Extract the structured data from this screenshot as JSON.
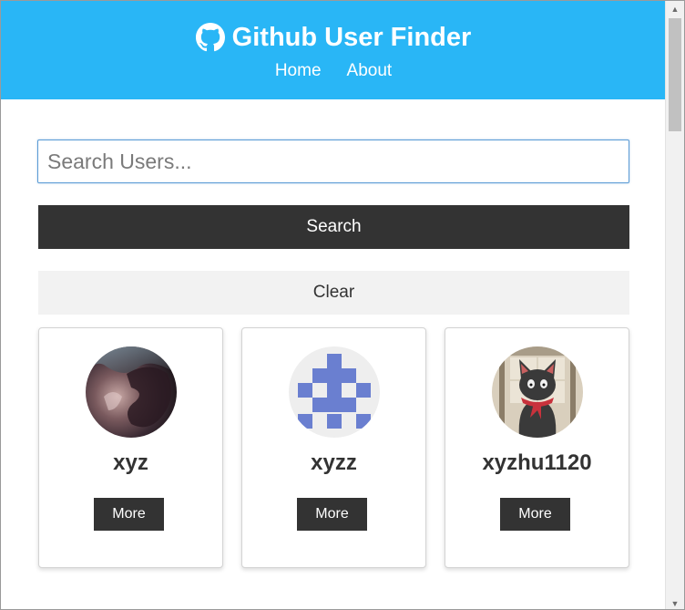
{
  "navbar": {
    "title": "Github User Finder",
    "icon": "github-icon",
    "links": [
      {
        "label": "Home"
      },
      {
        "label": "About"
      }
    ]
  },
  "search": {
    "placeholder": "Search Users...",
    "value": "",
    "search_label": "Search",
    "clear_label": "Clear"
  },
  "users": [
    {
      "login": "xyz",
      "more_label": "More",
      "avatar": "nebula-avatar"
    },
    {
      "login": "xyzz",
      "more_label": "More",
      "avatar": "identicon-avatar"
    },
    {
      "login": "xyzhu1120",
      "more_label": "More",
      "avatar": "black-cat-avatar"
    }
  ],
  "colors": {
    "navbar": "#29b6f6",
    "dark_button": "#333333",
    "light_button": "#f2f2f2",
    "identicon": "#6a7fd0"
  }
}
